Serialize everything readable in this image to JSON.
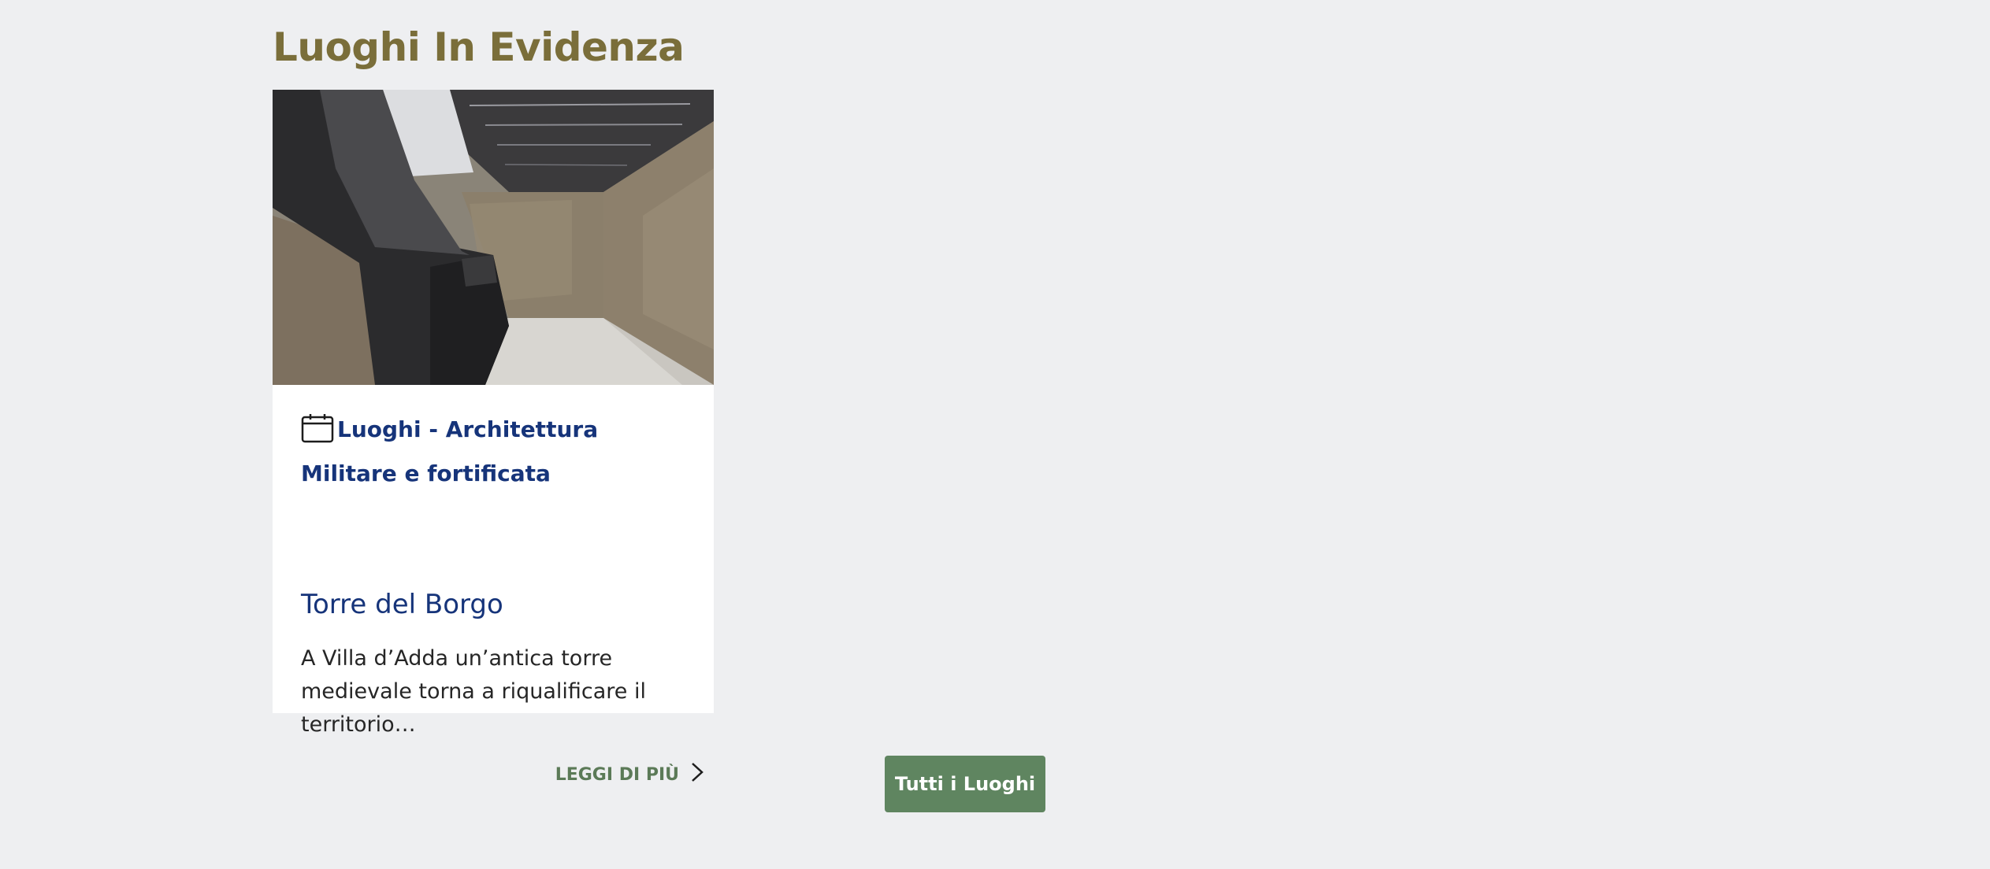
{
  "section": {
    "title": "Luoghi In Evidenza"
  },
  "card": {
    "category": "Luoghi - Architettura Militare e fortificata",
    "title": "Torre del Borgo",
    "description": "A Villa d’Adda un’antica torre medievale torna a riqualificare il territorio…",
    "read_more": "LEGGI DI PIÙ",
    "category_icon": "calendar-icon",
    "read_more_icon": "chevron-right-icon"
  },
  "all_button": {
    "label": "Tutti i Luoghi"
  },
  "colors": {
    "background": "#eeeff1",
    "title": "#7a6e3a",
    "link_blue": "#16347a",
    "read_more_green": "#5b7a57",
    "button_green": "#5f8560"
  }
}
